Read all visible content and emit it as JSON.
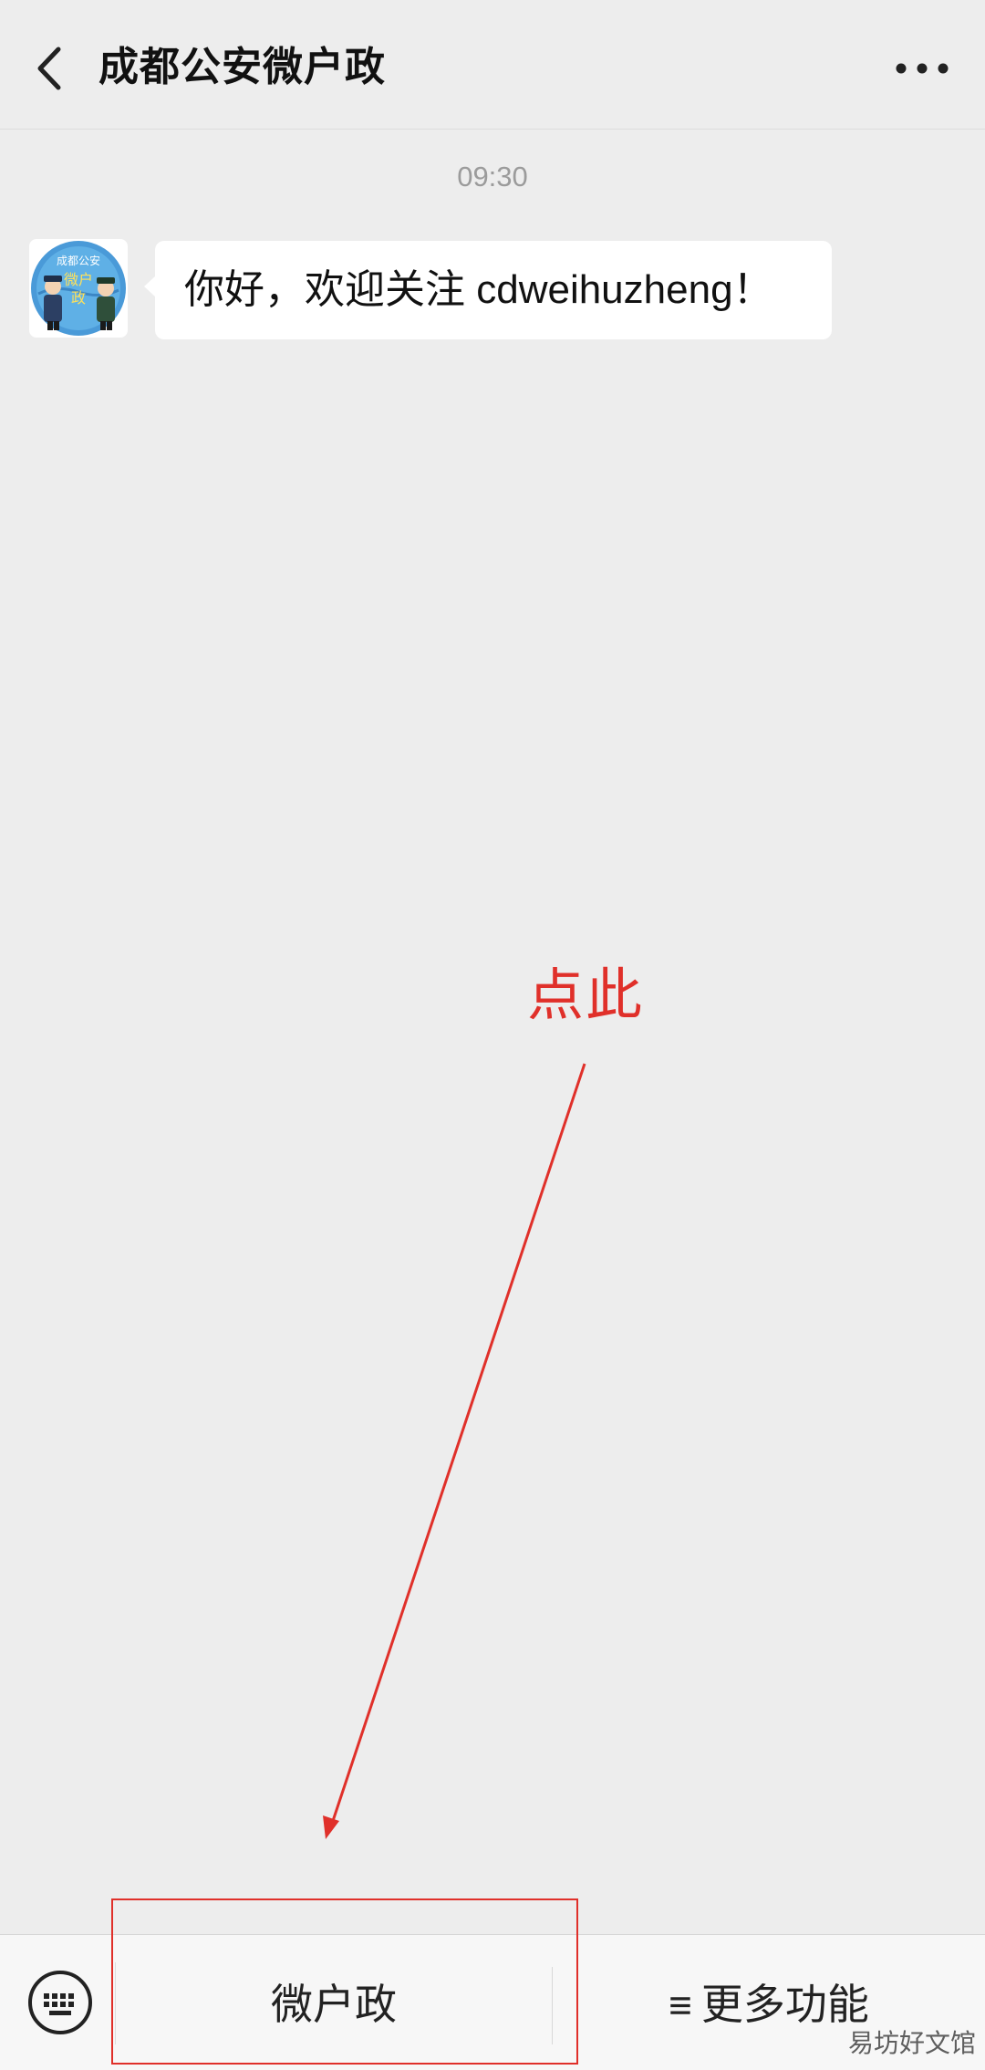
{
  "header": {
    "title": "成都公安微户政",
    "back_icon": "chevron-left-icon",
    "more_icon": "more-horizontal-icon"
  },
  "chat": {
    "timestamp": "09:30",
    "messages": [
      {
        "sender": "成都公安微户政",
        "avatar_text": [
          "成都公安",
          "微户",
          "政"
        ],
        "text": "你好，欢迎关注 cdweihuzheng！"
      }
    ]
  },
  "annotation": {
    "label": "点此",
    "color": "#e0302a"
  },
  "menu": {
    "keyboard_icon": "keyboard-icon",
    "items": [
      {
        "label": "微户政"
      },
      {
        "icon": "≡",
        "label": "更多功能"
      }
    ]
  },
  "watermark": "易坊好文馆"
}
